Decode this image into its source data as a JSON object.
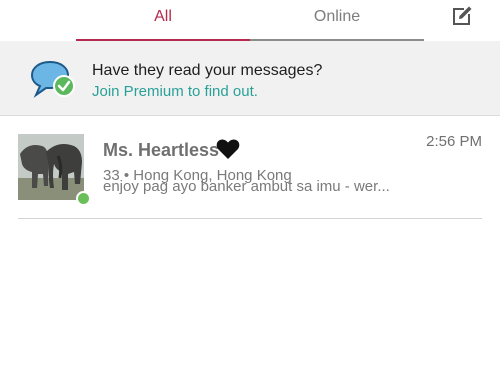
{
  "tabs": [
    {
      "label": "All",
      "active": true
    },
    {
      "label": "Online",
      "active": false
    }
  ],
  "toolbar": {
    "compose_icon": "compose-icon"
  },
  "banner": {
    "icon": "chat-bubble-check-icon",
    "title": "Have they read your messages?",
    "link": "Join Premium to find out."
  },
  "conversations": [
    {
      "name": "Ms. Heartless",
      "name_emoji": "black-heart-icon",
      "time": "2:56 PM",
      "meta": "33 • Hong Kong, Hong Kong",
      "preview": "enjoy pag ayo banker ambut sa imu - wer...",
      "online": true,
      "avatar": "elephants-photo"
    }
  ],
  "colors": {
    "accent": "#b5294f",
    "link": "#2aa198",
    "online": "#6bbf5a",
    "banner_bg": "#f1f1f1"
  }
}
